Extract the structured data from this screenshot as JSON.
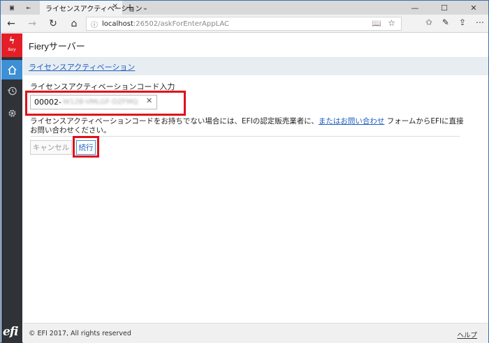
{
  "browser": {
    "tab_title": "ライセンスアクティベーション",
    "tab_close": "✕",
    "new_tab": "+",
    "tab_list": "⌄",
    "window_controls": {
      "minimize": "—",
      "maximize": "☐",
      "close": "✕"
    },
    "url_host": "localhost",
    "url_path": ":26502/askForEnterAppLAC"
  },
  "app": {
    "title": "Fieryサーバー",
    "logo_top_text": "fiery",
    "logo_bottom_text": "efi",
    "breadcrumb": "ライセンスアクティベーション",
    "field_label": "ライセンスアクティベーションコード入力",
    "input_value_prefix": "00002-",
    "input_value_obscured": "W12B-VMLGF-DZFMQ",
    "help_text_before": "ライセンスアクティベーションコードをお持ちでない場合には、EFIの認定販売業者に、",
    "help_link": "またはお問い合わせ",
    "help_text_after": " フォームからEFIに直接お問い合わせください。",
    "cancel_label": "キャンセル",
    "continue_label": "続行",
    "copyright": "© EFI 2017, All rights reserved",
    "help_label": "ヘルプ"
  },
  "colors": {
    "accent": "#3d8fd6",
    "highlight": "#e0101b",
    "sidebar": "#2f3338",
    "brand_red": "#e31e26"
  },
  "icons": [
    "back-icon",
    "forward-icon",
    "refresh-icon",
    "home-icon",
    "history-icon",
    "gear-icon",
    "star-icon",
    "pen-icon",
    "share-icon",
    "more-icon",
    "reading-view-icon",
    "info-icon"
  ]
}
